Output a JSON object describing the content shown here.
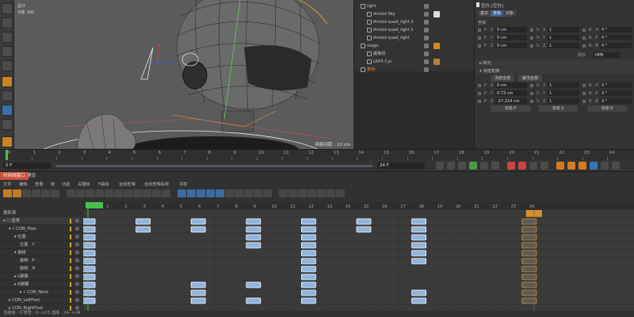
{
  "viewport": {
    "grid_label": "网格间距 : 10 cm",
    "info_line1": "总计",
    "info_line2": "对象  160"
  },
  "object_manager": {
    "rows": [
      {
        "name": "light",
        "depth": 0,
        "tag": ""
      },
      {
        "name": "Arnold Sky",
        "depth": 1,
        "tag": "#dddddd"
      },
      {
        "name": "Arnold quad_light 2",
        "depth": 1,
        "tag": ""
      },
      {
        "name": "Arnold quad_light 1",
        "depth": 1,
        "tag": ""
      },
      {
        "name": "Arnold quad_light",
        "depth": 1,
        "tag": ""
      },
      {
        "name": "stage",
        "depth": 0,
        "tag": "#d98a1a"
      },
      {
        "name": "摄像机",
        "depth": 1,
        "tag": ""
      },
      {
        "name": "LKP3 Cyc",
        "depth": 1,
        "tag": "#b88040"
      },
      {
        "name": "角色",
        "depth": 0,
        "tag": ""
      }
    ]
  },
  "attribute_manager": {
    "title": "空白 [空白]",
    "tabs": [
      "基本",
      "坐标",
      "对象"
    ],
    "section_coord": "坐标",
    "coord_rows": [
      {
        "p": "P . X",
        "pv": "0 cm",
        "s": "S . X",
        "sv": "1",
        "r": "R . H",
        "rv": "0 °"
      },
      {
        "p": "P . Y",
        "pv": "0 cm",
        "s": "S . Y",
        "sv": "1",
        "r": "R . P",
        "rv": "0 °"
      },
      {
        "p": "P . Z",
        "pv": "0 cm",
        "s": "S . Z",
        "sv": "1",
        "r": "R . B",
        "rv": "0 °"
      }
    ],
    "order_label": "顺序",
    "order_value": "HPB",
    "collapse_quat": "▸ 四元",
    "collapse_freeze": "▾ 冻结变换",
    "freeze_all": "冻结全部",
    "unfreeze_all": "解冻全部",
    "freeze_rows": [
      {
        "p": "P . X",
        "pv": "0 cm",
        "s": "S . X",
        "sv": "1",
        "r": "R . H",
        "rv": "0 °"
      },
      {
        "p": "P . Y",
        "pv": "0.73 cm",
        "s": "S . Y",
        "sv": "1",
        "r": "R . P",
        "rv": "0 °"
      },
      {
        "p": "P . Z",
        "pv": "-27.214 cm",
        "s": "S . Z",
        "sv": "1",
        "r": "R . B",
        "rv": "0 °"
      }
    ],
    "freeze_p": "冻结 P",
    "freeze_s": "冻结 S",
    "freeze_r": "冻结 R"
  },
  "ruler": {
    "ticks": [
      "0",
      "1",
      "2",
      "3",
      "4",
      "5",
      "6",
      "7",
      "8",
      "9",
      "10",
      "11",
      "12",
      "13",
      "14",
      "15",
      "16",
      "17",
      "18",
      "19",
      "20",
      "21",
      "22",
      "23",
      "24"
    ]
  },
  "transport": {
    "current_frame": "0 F",
    "end_frame": "24 F"
  },
  "timeline": {
    "tabs": [
      "时间线窗口",
      "通道"
    ],
    "menus": [
      "文件",
      "编辑",
      "查看",
      "帧",
      "功能",
      "关键帧",
      "F曲线",
      "运动剪辑",
      "运动剪辑系统",
      "书签"
    ],
    "label": "摄影表",
    "frames": [
      "0",
      "1",
      "2",
      "3",
      "4",
      "5",
      "6",
      "7",
      "8",
      "9",
      "10",
      "11",
      "12",
      "13",
      "14",
      "15",
      "16",
      "17",
      "18",
      "19",
      "20",
      "21",
      "22",
      "23",
      "24"
    ],
    "current_frame": 0,
    "preview_end": 24,
    "tracks": [
      {
        "name": "▾ ☐ 层界",
        "depth": 0
      },
      {
        "name": "▾ √ CON_Hips",
        "depth": 1
      },
      {
        "name": "▾ 位置",
        "depth": 2
      },
      {
        "name": "位置 . Y",
        "depth": 3
      },
      {
        "name": "▾ 旋转",
        "depth": 2
      },
      {
        "name": "旋转 . P",
        "depth": 3
      },
      {
        "name": "旋转 . H",
        "depth": 3
      },
      {
        "name": "▸ L脚踝",
        "depth": 2
      },
      {
        "name": "▸ R脚踝",
        "depth": 2
      },
      {
        "name": "▸ √ CON_Neck",
        "depth": 3
      },
      {
        "name": "▸ CON_LeftFoot",
        "depth": 1
      },
      {
        "name": "▸ CON_RightFoot",
        "depth": 1
      }
    ],
    "keys": [
      {
        "row": 0,
        "frames": [
          0,
          3,
          6,
          9,
          12,
          15,
          18,
          24
        ]
      },
      {
        "row": 1,
        "frames": [
          0,
          3,
          6,
          9,
          12,
          15,
          18,
          24
        ]
      },
      {
        "row": 2,
        "frames": [
          0,
          9,
          12,
          18,
          24
        ]
      },
      {
        "row": 3,
        "frames": [
          0,
          9,
          12,
          18,
          24
        ]
      },
      {
        "row": 4,
        "frames": [
          0,
          12,
          18,
          24
        ]
      },
      {
        "row": 5,
        "frames": [
          0,
          12,
          18,
          24
        ]
      },
      {
        "row": 6,
        "frames": [
          0,
          12,
          24
        ]
      },
      {
        "row": 7,
        "frames": [
          0,
          12,
          24
        ]
      },
      {
        "row": 8,
        "frames": [
          0,
          6,
          9,
          12,
          24
        ]
      },
      {
        "row": 9,
        "frames": [
          0,
          6,
          12,
          18,
          24
        ]
      },
      {
        "row": 10,
        "frames": [
          0,
          6,
          9,
          12,
          18,
          24
        ]
      }
    ],
    "status": "当前帧 : 0   预览 : 0-->23   选择 : 24-->24"
  },
  "colors": {
    "accent": "#3d5e8f",
    "key_fill": "#8fb4dd",
    "key_selected": "#d6902a",
    "timeline_tab": "#c8503a"
  }
}
